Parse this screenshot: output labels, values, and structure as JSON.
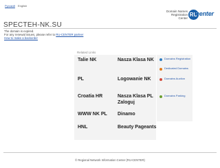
{
  "lang": {
    "ru": "Русский",
    "en": "English"
  },
  "header": {
    "reg_lines": [
      "Domain Names",
      "Registration",
      "Center"
    ],
    "logo_letters": "RU",
    "logo_word": "center"
  },
  "domain": {
    "title": "SPECTEH-NK.SU",
    "expired_text": "The domain is expired.",
    "renewal_text": "For any renewal issues, please refer to",
    "renewal_link": "RU-CENTER partner",
    "backorder_link": "How to make a backorder"
  },
  "related": {
    "heading": "Related Links",
    "links": [
      "Talie NK",
      "Nasza Klasa NK",
      "PL",
      "Logowanie NK",
      "Croatia HR",
      "Nasza Klasa PL Zaloguj",
      "WWW NK PL",
      "Dinamo",
      "HNL",
      "Beauty Pageants"
    ]
  },
  "sidebar": {
    "items": [
      {
        "label": "Domains Registration",
        "icon": "globe-icon",
        "color": "#2f7cc0"
      },
      {
        "label": "Dedicated Domains",
        "icon": "server-icon",
        "color": "#e07a1a"
      },
      {
        "label": "Domains Auction",
        "icon": "auction-icon",
        "color": "#d04a3a"
      },
      {
        "label": "Domains Parking",
        "icon": "parking-icon",
        "color": "#6a9e2f"
      }
    ]
  },
  "footer": {
    "text": "© Regional Network Information Center (RU-CENTER)"
  },
  "colors": {
    "brand": "#1a5fa8",
    "link": "#2255aa",
    "box": "#f3f3f3"
  }
}
